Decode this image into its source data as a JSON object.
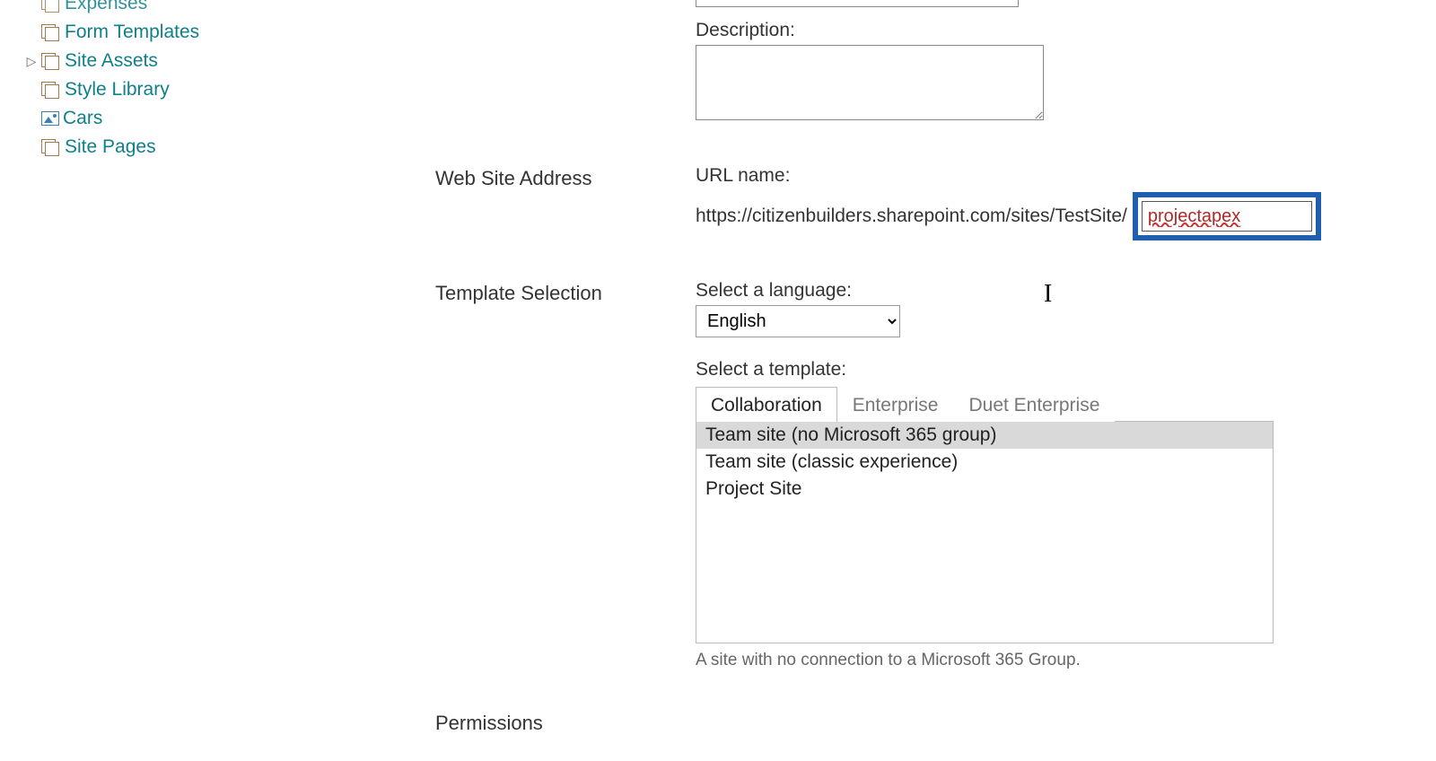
{
  "nav": {
    "items": [
      {
        "label": "Expenses",
        "icon": "lib",
        "expandable": false,
        "topcut": true
      },
      {
        "label": "Form Templates",
        "icon": "lib",
        "expandable": false
      },
      {
        "label": "Site Assets",
        "icon": "lib",
        "expandable": true
      },
      {
        "label": "Style Library",
        "icon": "lib",
        "expandable": false
      },
      {
        "label": "Cars",
        "icon": "pic",
        "expandable": false
      },
      {
        "label": "Site Pages",
        "icon": "lib",
        "expandable": false
      }
    ]
  },
  "form": {
    "description_label": "Description:",
    "description_value": "",
    "web_address_heading": "Web Site Address",
    "url_label": "URL name:",
    "url_prefix": "https://citizenbuilders.sharepoint.com/sites/TestSite/",
    "url_value": "projectapex",
    "template_heading": "Template Selection",
    "language_label": "Select a language:",
    "language_value": "English",
    "language_options": [
      "English"
    ],
    "select_template_label": "Select a template:",
    "template_tabs": [
      "Collaboration",
      "Enterprise",
      "Duet Enterprise"
    ],
    "template_tab_active": 0,
    "templates": [
      "Team site (no Microsoft 365 group)",
      "Team site (classic experience)",
      "Project Site"
    ],
    "template_selected": 0,
    "template_description": "A site with no connection to a Microsoft 365 Group.",
    "permissions_heading": "Permissions"
  }
}
